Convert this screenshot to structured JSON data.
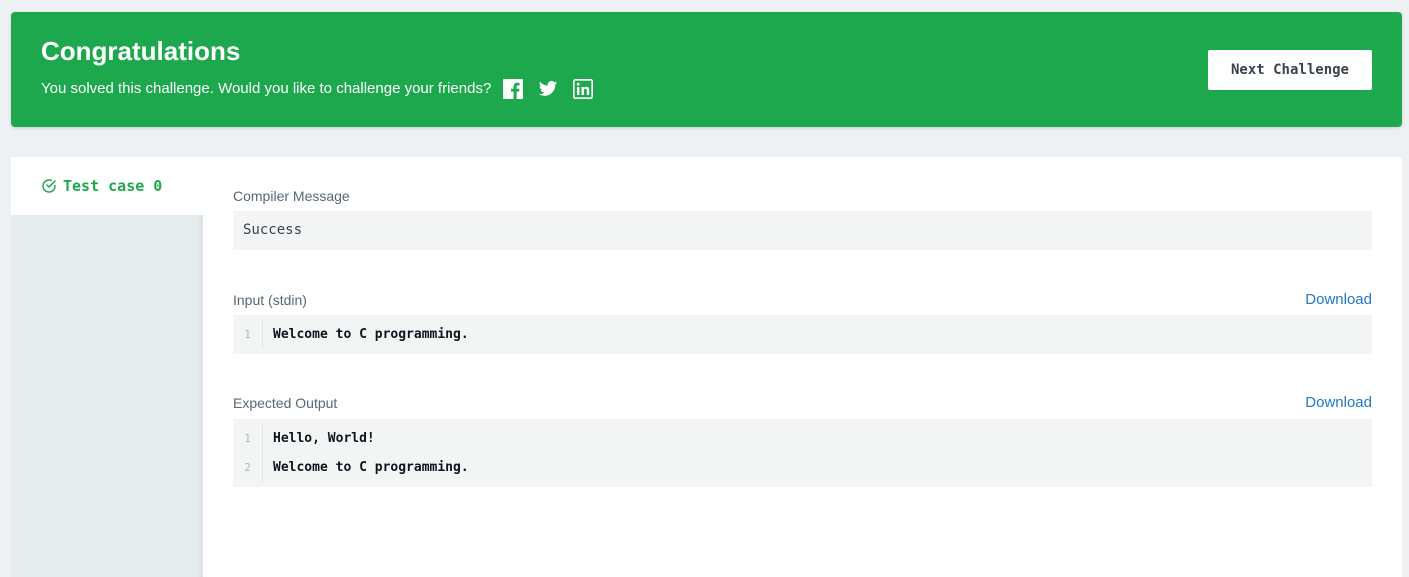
{
  "banner": {
    "title": "Congratulations",
    "subtitle": "You solved this challenge. Would you like to challenge your friends?",
    "share_icons": [
      "facebook-icon",
      "twitter-icon",
      "linkedin-icon"
    ],
    "next_button": "Next Challenge",
    "color": "#1ea84d"
  },
  "tabs": [
    {
      "label": "Test case 0",
      "status": "passed"
    }
  ],
  "compiler": {
    "label": "Compiler Message",
    "message": "Success"
  },
  "input": {
    "label": "Input (stdin)",
    "download": "Download",
    "lines": [
      {
        "num": "1",
        "text": "Welcome to C programming."
      }
    ]
  },
  "expected": {
    "label": "Expected Output",
    "download": "Download",
    "lines": [
      {
        "num": "1",
        "text": "Hello, World!"
      },
      {
        "num": "2",
        "text": "Welcome to C programming."
      }
    ]
  }
}
